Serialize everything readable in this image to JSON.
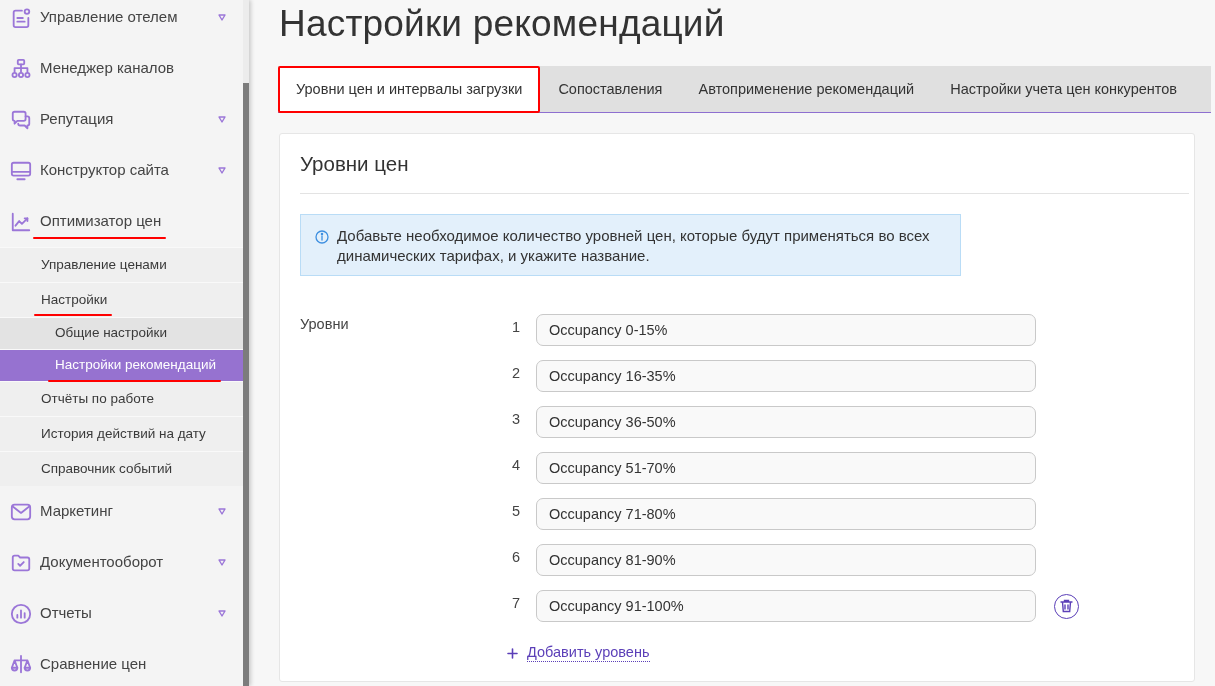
{
  "sidebar": {
    "items": [
      {
        "label": "Управление отелем",
        "collapsed": true,
        "selected": false,
        "annotated": false
      },
      {
        "label": "Менеджер каналов",
        "collapsed": false,
        "selected": false,
        "annotated": false
      },
      {
        "label": "Репутация",
        "collapsed": true,
        "selected": false,
        "annotated": false
      },
      {
        "label": "Конструктор сайта",
        "collapsed": true,
        "selected": false,
        "annotated": false
      },
      {
        "label": "Оптимизатор цен",
        "collapsed": false,
        "selected": false,
        "annotated": true,
        "children": [
          {
            "label": "Управление ценами",
            "selected": false,
            "annotated": false
          },
          {
            "label": "Настройки",
            "selected": false,
            "annotated": true,
            "children": [
              {
                "label": "Общие настройки",
                "selected": false,
                "annotated": false
              },
              {
                "label": "Настройки рекомендаций",
                "selected": true,
                "annotated": true
              }
            ]
          },
          {
            "label": "Отчёты по работе",
            "selected": false,
            "annotated": false
          },
          {
            "label": "История действий на дату",
            "selected": false,
            "annotated": false
          },
          {
            "label": "Справочник событий",
            "selected": false,
            "annotated": false
          }
        ]
      },
      {
        "label": "Маркетинг",
        "collapsed": true,
        "selected": false,
        "annotated": false
      },
      {
        "label": "Документооборот",
        "collapsed": true,
        "selected": false,
        "annotated": false
      },
      {
        "label": "Отчеты",
        "collapsed": true,
        "selected": false,
        "annotated": false
      },
      {
        "label": "Сравнение цен",
        "collapsed": false,
        "selected": false,
        "annotated": false
      }
    ]
  },
  "page_title": "Настройки рекомендаций",
  "tabs": [
    {
      "label": "Уровни цен и интервалы загрузки",
      "selected": true,
      "annotated": true
    },
    {
      "label": "Сопоставления",
      "selected": false,
      "annotated": false
    },
    {
      "label": "Автоприменение рекомендаций",
      "selected": false,
      "annotated": false
    },
    {
      "label": "Настройки учета цен конкурентов",
      "selected": false,
      "annotated": false
    }
  ],
  "card": {
    "title": "Уровни цен",
    "notice": "Добавьте необходимое количество уровней цен, которые будут применяться во всех динамических тарифах, и укажите название.",
    "levels_label": "Уровни",
    "levels": [
      {
        "number": "1",
        "value": "Occupancy 0-15%",
        "removable": false
      },
      {
        "number": "2",
        "value": "Occupancy 16-35%",
        "removable": false
      },
      {
        "number": "3",
        "value": "Occupancy 36-50%",
        "removable": false
      },
      {
        "number": "4",
        "value": "Occupancy 51-70%",
        "removable": false
      },
      {
        "number": "5",
        "value": "Occupancy 71-80%",
        "removable": false
      },
      {
        "number": "6",
        "value": "Occupancy 81-90%",
        "removable": false
      },
      {
        "number": "7",
        "value": "Occupancy 91-100%",
        "removable": true
      }
    ],
    "add_link": "Добавить уровень"
  }
}
